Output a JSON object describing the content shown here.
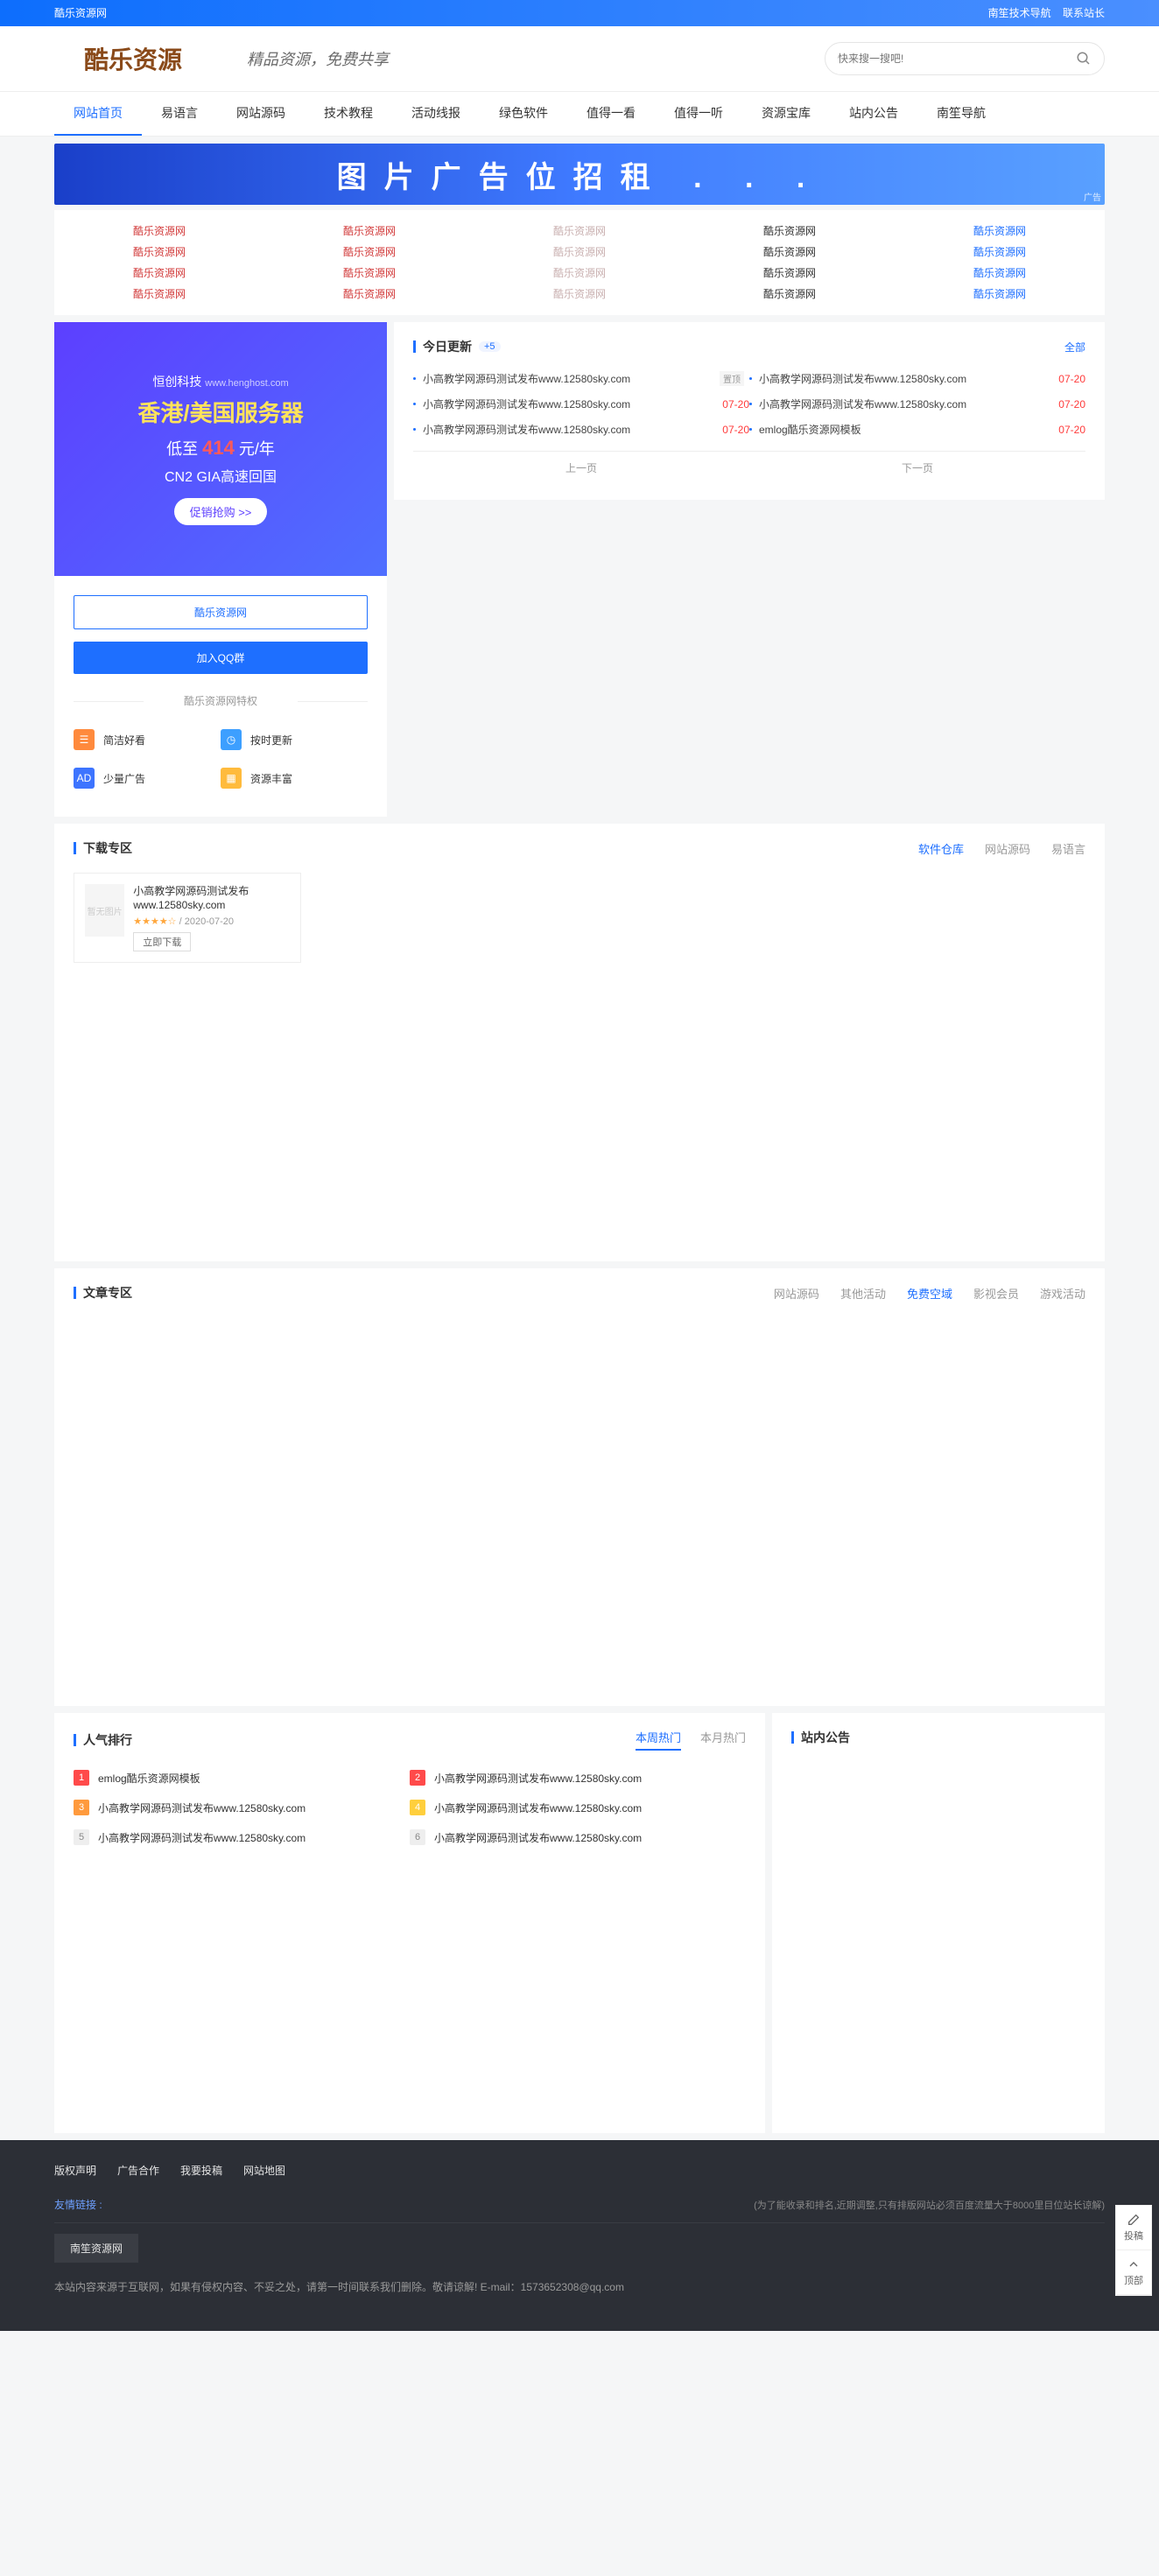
{
  "topbar": {
    "site": "酷乐资源网",
    "links": [
      "南笙技术导航",
      "联系站长"
    ]
  },
  "header": {
    "site_name": "酷乐资源",
    "slogan": "精品资源，免费共享",
    "search_placeholder": "快来搜一搜吧!"
  },
  "nav": [
    "网站首页",
    "易语言",
    "网站源码",
    "技术教程",
    "活动线报",
    "绿色软件",
    "值得一看",
    "值得一听",
    "资源宝库",
    "站内公告",
    "南笙导航"
  ],
  "adbanner": {
    "text": "图片广告位招租 . . .",
    "tag": "广告"
  },
  "linkgrid_text": "酷乐资源网",
  "sidebanner": {
    "brand": "恒创科技",
    "url": "www.henghost.com",
    "l2": "香港/美国服务器",
    "l3_a": "低至 ",
    "l3_b": "414",
    "l3_c": " 元/年",
    "l4": "CN2 GIA高速回国",
    "btn": "促销抢购 >>"
  },
  "sidecard": {
    "btn1": "酷乐资源网",
    "btn2": "加入QQ群",
    "divider": "酷乐资源网特权",
    "features": [
      "简洁好看",
      "按时更新",
      "少量广告",
      "资源丰富"
    ]
  },
  "today": {
    "title": "今日更新",
    "count": "+5",
    "more": "全部",
    "items": [
      {
        "t": "小高教学网源码测试发布www.12580sky.com",
        "tag": "置顶",
        "d": ""
      },
      {
        "t": "小高教学网源码测试发布www.12580sky.com",
        "d": "07-20"
      },
      {
        "t": "小高教学网源码测试发布www.12580sky.com",
        "d": "07-20"
      },
      {
        "t": "小高教学网源码测试发布www.12580sky.com",
        "d": "07-20"
      },
      {
        "t": "小高教学网源码测试发布www.12580sky.com",
        "d": "07-20"
      },
      {
        "t": "emlog酷乐资源网模板",
        "d": "07-20"
      }
    ],
    "prev": "上一页",
    "next": "下一页"
  },
  "download": {
    "title": "下载专区",
    "tabs": [
      "软件仓库",
      "网站源码",
      "易语言"
    ],
    "card": {
      "title": "小高教学网源码测试发布www.12580sky.com",
      "stars": "★★★★☆",
      "date": "2020-07-20",
      "btn": "立即下载",
      "thumbtext": "暂无图片"
    }
  },
  "articles": {
    "title": "文章专区",
    "tabs": [
      "网站源码",
      "其他活动",
      "免费空域",
      "影视会员",
      "游戏活动"
    ],
    "active": 2
  },
  "rank": {
    "title": "人气排行",
    "tabs": [
      "本周热门",
      "本月热门"
    ],
    "items": [
      "emlog酷乐资源网模板",
      "小高教学网源码测试发布www.12580sky.com",
      "小高教学网源码测试发布www.12580sky.com",
      "小高教学网源码测试发布www.12580sky.com",
      "小高教学网源码测试发布www.12580sky.com",
      "小高教学网源码测试发布www.12580sky.com"
    ]
  },
  "notice": {
    "title": "站内公告"
  },
  "float": {
    "a": "投稿",
    "b": "顶部"
  },
  "footer": {
    "links": [
      "版权声明",
      "广告合作",
      "我要投稿",
      "网站地图"
    ],
    "friend_label": "友情链接 :",
    "friend_note": "(为了能收录和排名,近期调整,只有排版网站必须百度流量大于8000里目位站长谅解)",
    "friend_site": "南笙资源网",
    "copy": "本站内容来源于互联网，如果有侵权内容、不妥之处，请第一时间联系我们删除。敬请谅解! E-mail：1573652308@qq.com"
  }
}
